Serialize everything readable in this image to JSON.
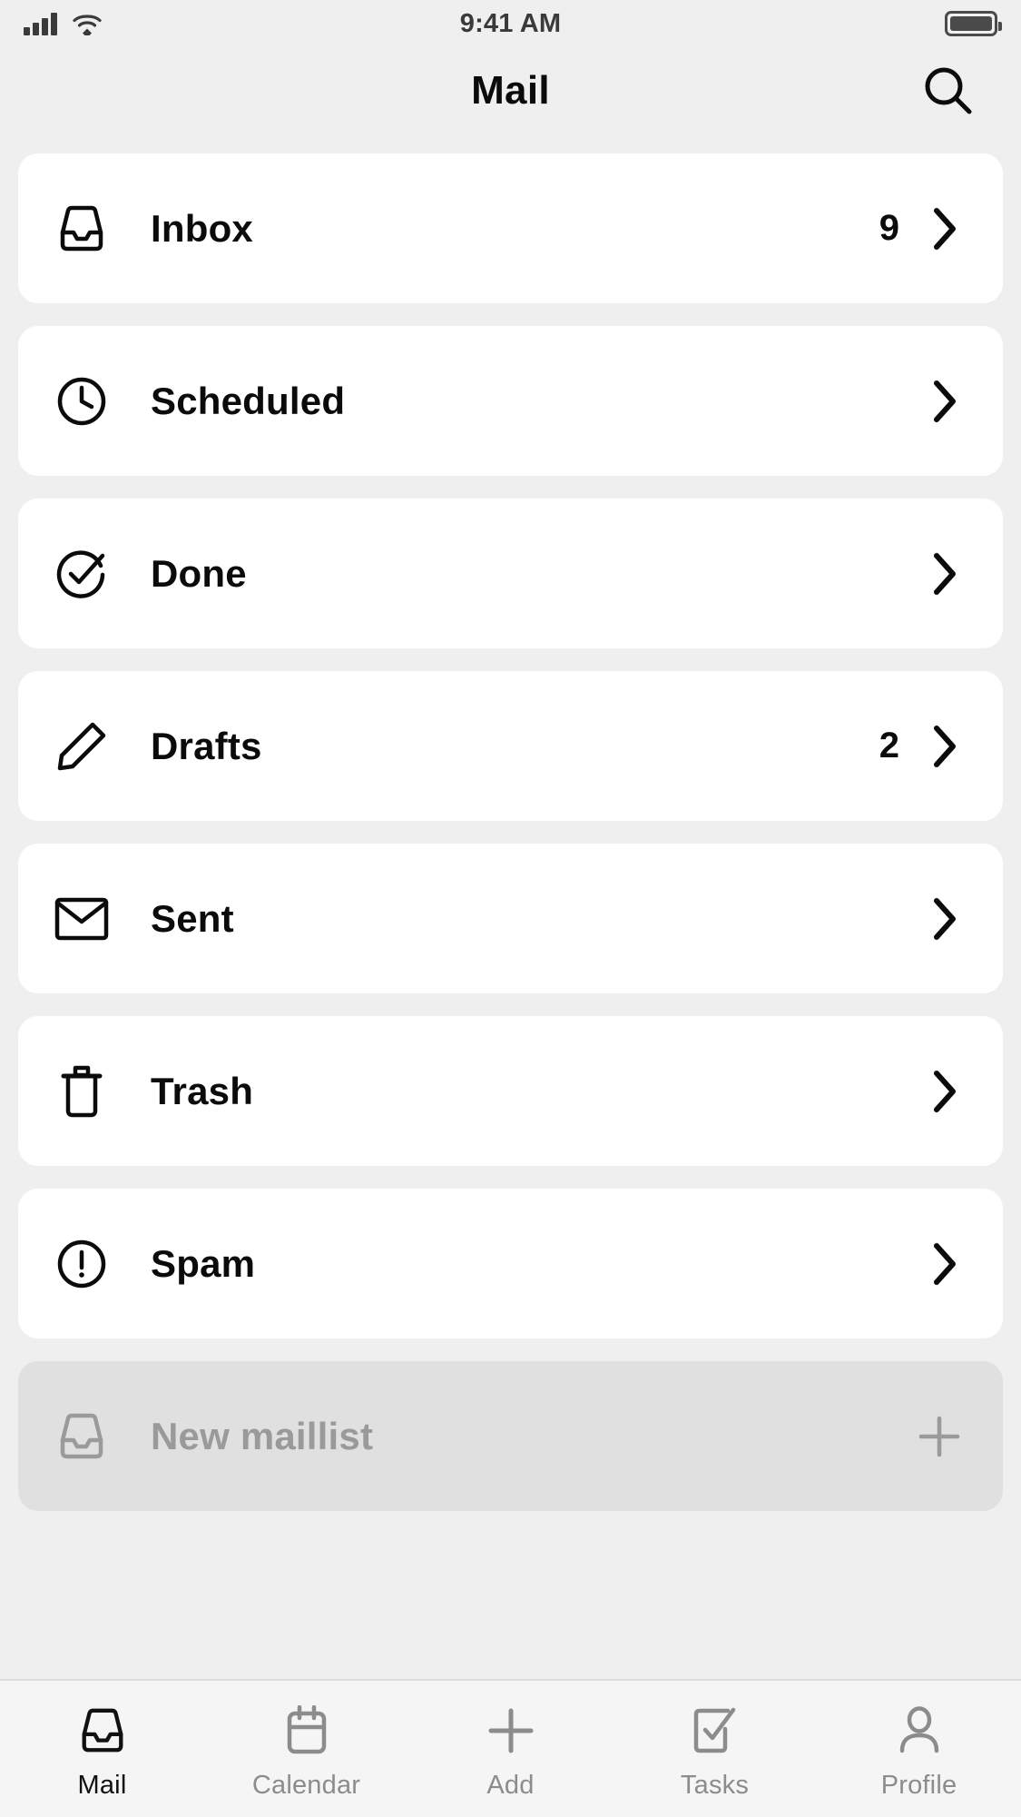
{
  "status_bar": {
    "time": "9:41 AM",
    "signal_icon": "cellular-signal-icon",
    "wifi_icon": "wifi-icon",
    "battery_icon": "battery-icon"
  },
  "header": {
    "title": "Mail",
    "search_icon": "search-icon"
  },
  "colors": {
    "background": "#efefef",
    "card": "#ffffff",
    "muted_card": "#e0e0e0",
    "text": "#0b0b0b",
    "muted_text": "#9a9a9a",
    "tabbar": "#f5f5f5",
    "tab_inactive": "#8c8c8c",
    "tab_active": "#111111"
  },
  "mailboxes": [
    {
      "label": "Inbox",
      "icon": "inbox-icon",
      "badge": "9",
      "chevron": "chevron-right-icon"
    },
    {
      "label": "Scheduled",
      "icon": "clock-icon",
      "badge": "",
      "chevron": "chevron-right-icon"
    },
    {
      "label": "Done",
      "icon": "check-circle-icon",
      "badge": "",
      "chevron": "chevron-right-icon"
    },
    {
      "label": "Drafts",
      "icon": "pencil-icon",
      "badge": "2",
      "chevron": "chevron-right-icon"
    },
    {
      "label": "Sent",
      "icon": "envelope-icon",
      "badge": "",
      "chevron": "chevron-right-icon"
    },
    {
      "label": "Trash",
      "icon": "trash-icon",
      "badge": "",
      "chevron": "chevron-right-icon"
    },
    {
      "label": "Spam",
      "icon": "alert-circle-icon",
      "badge": "",
      "chevron": "chevron-right-icon"
    }
  ],
  "new_maillist": {
    "label": "New maillist",
    "icon": "inbox-icon",
    "action_icon": "plus-icon"
  },
  "tabs": [
    {
      "label": "Mail",
      "icon": "inbox-icon",
      "active": true
    },
    {
      "label": "Calendar",
      "icon": "calendar-icon",
      "active": false
    },
    {
      "label": "Add",
      "icon": "plus-icon",
      "active": false
    },
    {
      "label": "Tasks",
      "icon": "tasks-icon",
      "active": false
    },
    {
      "label": "Profile",
      "icon": "person-icon",
      "active": false
    }
  ]
}
